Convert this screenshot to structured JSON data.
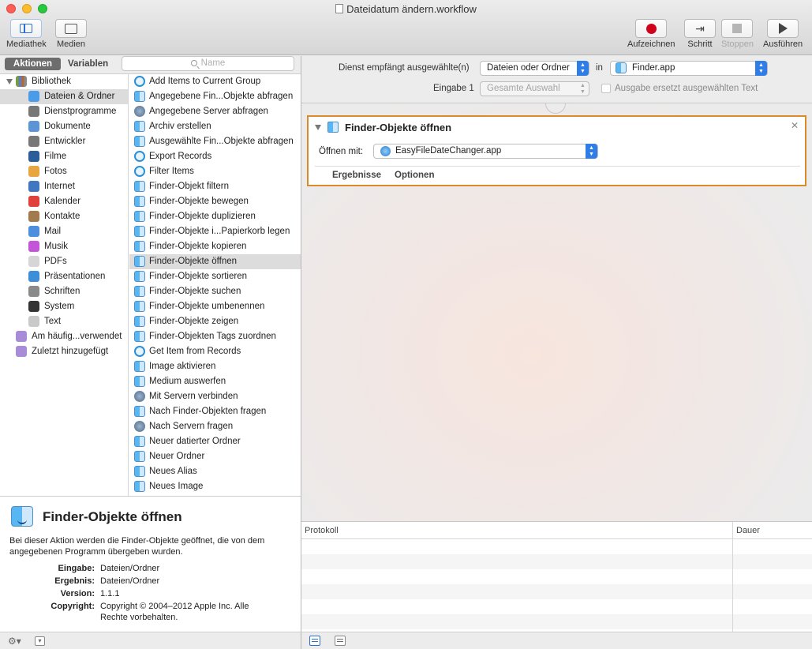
{
  "window": {
    "title": "Dateidatum ändern.workflow"
  },
  "toolbar": {
    "library": "Mediathek",
    "media": "Medien",
    "record": "Aufzeichnen",
    "step": "Schritt",
    "stop": "Stoppen",
    "run": "Ausführen"
  },
  "left_tabs": {
    "actions": "Aktionen",
    "variables": "Variablen"
  },
  "search": {
    "placeholder": "Name"
  },
  "library": {
    "root": "Bibliothek",
    "categories": [
      {
        "label": "Dateien & Ordner",
        "icon": "finder-icon",
        "color": "#4a9be8"
      },
      {
        "label": "Dienstprogramme",
        "icon": "tools-icon",
        "color": "#777777"
      },
      {
        "label": "Dokumente",
        "icon": "document-icon",
        "color": "#5b95d6"
      },
      {
        "label": "Entwickler",
        "icon": "tools-icon",
        "color": "#777777"
      },
      {
        "label": "Filme",
        "icon": "quicktime-icon",
        "color": "#2a5d9a"
      },
      {
        "label": "Fotos",
        "icon": "photos-icon",
        "color": "#e7a640"
      },
      {
        "label": "Internet",
        "icon": "globe-icon",
        "color": "#4177c0"
      },
      {
        "label": "Kalender",
        "icon": "calendar-icon",
        "color": "#e0413a"
      },
      {
        "label": "Kontakte",
        "icon": "contacts-icon",
        "color": "#a17b4d"
      },
      {
        "label": "Mail",
        "icon": "mail-icon",
        "color": "#4d8fdc"
      },
      {
        "label": "Musik",
        "icon": "music-icon",
        "color": "#c455d9"
      },
      {
        "label": "PDFs",
        "icon": "pdf-icon",
        "color": "#d6d6d6"
      },
      {
        "label": "Präsentationen",
        "icon": "presentation-icon",
        "color": "#3d8ed8"
      },
      {
        "label": "Schriften",
        "icon": "font-icon",
        "color": "#8a8a8a"
      },
      {
        "label": "System",
        "icon": "system-icon",
        "color": "#333333"
      },
      {
        "label": "Text",
        "icon": "text-icon",
        "color": "#c9c9c9"
      }
    ],
    "smart": [
      {
        "label": "Am häufig...verwendet",
        "icon": "smart-folder-icon",
        "color": "#a88cd8"
      },
      {
        "label": "Zuletzt hinzugefügt",
        "icon": "smart-folder-icon",
        "color": "#a88cd8"
      }
    ]
  },
  "actions": [
    {
      "label": "Add Items to Current Group",
      "icon": "swirl-icon"
    },
    {
      "label": "Angegebene Fin...Objekte abfragen",
      "icon": "finder-icon"
    },
    {
      "label": "Angegebene Server abfragen",
      "icon": "network-icon"
    },
    {
      "label": "Archiv erstellen",
      "icon": "finder-icon"
    },
    {
      "label": "Ausgewählte Fin...Objekte abfragen",
      "icon": "finder-icon"
    },
    {
      "label": "Export Records",
      "icon": "swirl-icon"
    },
    {
      "label": "Filter Items",
      "icon": "swirl-icon"
    },
    {
      "label": "Finder-Objekt filtern",
      "icon": "finder-icon"
    },
    {
      "label": "Finder-Objekte bewegen",
      "icon": "finder-icon"
    },
    {
      "label": "Finder-Objekte duplizieren",
      "icon": "finder-icon"
    },
    {
      "label": "Finder-Objekte i...Papierkorb legen",
      "icon": "finder-icon"
    },
    {
      "label": "Finder-Objekte kopieren",
      "icon": "finder-icon"
    },
    {
      "label": "Finder-Objekte öffnen",
      "icon": "finder-icon"
    },
    {
      "label": "Finder-Objekte sortieren",
      "icon": "finder-icon"
    },
    {
      "label": "Finder-Objekte suchen",
      "icon": "finder-icon"
    },
    {
      "label": "Finder-Objekte umbenennen",
      "icon": "finder-icon"
    },
    {
      "label": "Finder-Objekte zeigen",
      "icon": "finder-icon"
    },
    {
      "label": "Finder-Objekten Tags zuordnen",
      "icon": "finder-icon"
    },
    {
      "label": "Get Item from Records",
      "icon": "swirl-icon"
    },
    {
      "label": "Image aktivieren",
      "icon": "finder-icon"
    },
    {
      "label": "Medium auswerfen",
      "icon": "finder-icon"
    },
    {
      "label": "Mit Servern verbinden",
      "icon": "network-icon"
    },
    {
      "label": "Nach Finder-Objekten fragen",
      "icon": "finder-icon"
    },
    {
      "label": "Nach Servern fragen",
      "icon": "network-icon"
    },
    {
      "label": "Neuer datierter Ordner",
      "icon": "finder-icon"
    },
    {
      "label": "Neuer Ordner",
      "icon": "finder-icon"
    },
    {
      "label": "Neues Alias",
      "icon": "finder-icon"
    },
    {
      "label": "Neues Image",
      "icon": "finder-icon"
    }
  ],
  "description": {
    "title": "Finder-Objekte öffnen",
    "text": "Bei dieser Aktion werden die Finder-Objekte geöffnet, die von dem angegebenen Programm übergeben wurden.",
    "fields": [
      {
        "key": "Eingabe:",
        "value": "Dateien/Ordner"
      },
      {
        "key": "Ergebnis:",
        "value": "Dateien/Ordner"
      },
      {
        "key": "Version:",
        "value": "1.1.1"
      },
      {
        "key": "Copyright:",
        "value": "Copyright © 2004–2012 Apple Inc. Alle Rechte vorbehalten."
      }
    ]
  },
  "service": {
    "receives_label": "Dienst empfängt ausgewählte(n)",
    "receives_value": "Dateien oder Ordner",
    "in_label": "in",
    "app_value": "Finder.app",
    "input_label": "Eingabe",
    "input_num": "1",
    "input_value": "Gesamte Auswahl",
    "replace_label": "Ausgabe ersetzt ausgewählten Text"
  },
  "action_card": {
    "title": "Finder-Objekte öffnen",
    "open_with_label": "Öffnen mit:",
    "open_with_value": "EasyFileDateChanger.app",
    "tab_results": "Ergebnisse",
    "tab_options": "Optionen"
  },
  "log": {
    "col_log": "Protokoll",
    "col_duration": "Dauer"
  },
  "colors": {
    "accent": "#2f7ee8",
    "action_border": "#d98a2c",
    "record": "#d0021b"
  }
}
